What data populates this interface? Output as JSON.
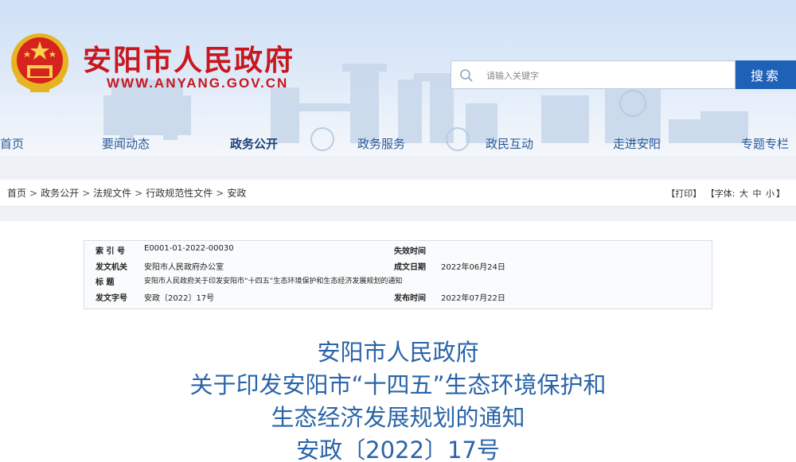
{
  "header": {
    "site_title": "安阳市人民政府",
    "site_url": "WWW.ANYANG.GOV.CN",
    "search_placeholder": "请输入关键字",
    "search_button": "搜索",
    "brand_color": "#c8171e",
    "accent_color": "#1e62b8"
  },
  "nav": {
    "items": [
      {
        "label": "首页"
      },
      {
        "label": "要闻动态"
      },
      {
        "label": "政务公开"
      },
      {
        "label": "政务服务"
      },
      {
        "label": "政民互动"
      },
      {
        "label": "走进安阳"
      },
      {
        "label": "专题专栏"
      }
    ],
    "active": "政务公开"
  },
  "breadcrumb": {
    "items": [
      "首页",
      "政务公开",
      "法规文件",
      "行政规范性文件",
      "安政"
    ],
    "separator": ">"
  },
  "tools": {
    "print": "【打印】",
    "font_label": "【字体:",
    "large": "大",
    "medium": "中",
    "small": "小",
    "close": "】"
  },
  "meta": {
    "index_label": "索  引  号",
    "index_value": "E0001-01-2022-00030",
    "expiry_label": "失效时间",
    "expiry_value": "",
    "issuer_label": "发文机关",
    "issuer_value": "安阳市人民政府办公室",
    "written_label": "成文日期",
    "written_value": "2022年06月24日",
    "title_label": "标      题",
    "title_value": "安阳市人民政府关于印发安阳市“十四五”生态环境保护和生态经济发展规划的通知",
    "number_label": "发文字号",
    "number_value": "安政〔2022〕17号",
    "published_label": "发布时间",
    "published_value": "2022年07月22日"
  },
  "document": {
    "title_lines": [
      "安阳市人民政府",
      "关于印发安阳市“十四五”生态环境保护和",
      "生态经济发展规划的通知",
      "安政〔2022〕17号"
    ]
  }
}
